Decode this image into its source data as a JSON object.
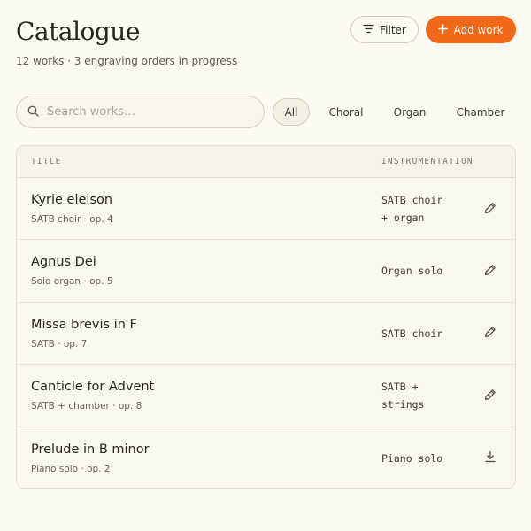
{
  "header": {
    "title": "Catalogue",
    "subtitle": "12 works · 3 engraving orders in progress",
    "filter_label": "Filter",
    "add_label": "Add work",
    "accent_color": "#f16818"
  },
  "search": {
    "placeholder": "Search works…",
    "value": ""
  },
  "chips": [
    {
      "label": "All",
      "active": true
    },
    {
      "label": "Choral",
      "active": false
    },
    {
      "label": "Organ",
      "active": false
    },
    {
      "label": "Chamber",
      "active": false
    }
  ],
  "table": {
    "columns": [
      "TITLE",
      "INSTRUMENTATION"
    ],
    "rows": [
      {
        "title": "Kyrie eleison",
        "meta": "SATB choir · op. 4",
        "instrumentation": "SATB choir\n+ organ",
        "action_icon": "pencil-icon"
      },
      {
        "title": "Agnus Dei",
        "meta": "Solo organ · op. 5",
        "instrumentation": "Organ solo",
        "action_icon": "pencil-icon"
      },
      {
        "title": "Missa brevis in F",
        "meta": "SATB · op. 7",
        "instrumentation": "SATB choir",
        "action_icon": "pencil-icon"
      },
      {
        "title": "Canticle for Advent",
        "meta": "SATB + chamber · op. 8",
        "instrumentation": "SATB +\nstrings",
        "action_icon": "pencil-icon"
      },
      {
        "title": "Prelude in B minor",
        "meta": "Piano solo · op. 2",
        "instrumentation": "Piano solo",
        "action_icon": "download-icon"
      }
    ]
  }
}
